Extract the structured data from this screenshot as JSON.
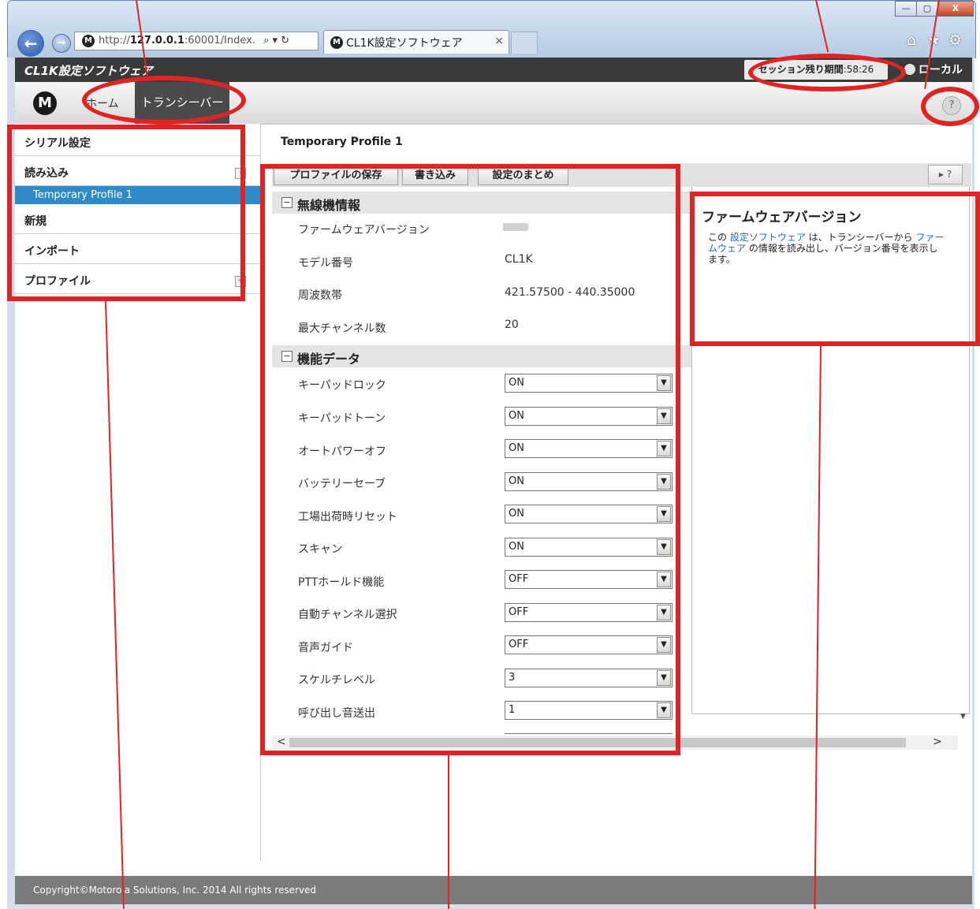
{
  "browser": {
    "address_prefix": "http://",
    "address_host": "127.0.0.1",
    "address_rest": ":60001/Index.",
    "address_tools": "⌕ ▾ ↻",
    "tab_title": "CL1K設定ソフトウェア",
    "tab_close": "×",
    "window_buttons": {
      "minimize": "—",
      "maximize": "▢",
      "close": "X"
    },
    "icons": {
      "home": "⌂",
      "favorites": "★",
      "settings": "⚙"
    }
  },
  "app": {
    "title": "CL1K設定ソフトウェア",
    "session_label": "セッション残り期間",
    "session_time": ":58:26",
    "local_label": "ローカル"
  },
  "nav": {
    "home": "ホーム",
    "transceiver": "トランシーバー",
    "help": "?"
  },
  "sidebar": {
    "items": [
      {
        "label": "シリアル設定"
      },
      {
        "label": "読み込み",
        "toggle": "-"
      },
      {
        "label": "新規"
      },
      {
        "label": "インポート"
      },
      {
        "label": "プロファイル",
        "toggle": "+"
      }
    ],
    "selected_sub": "Temporary Profile 1"
  },
  "main": {
    "title": "Temporary Profile 1",
    "toolbar": {
      "save": "プロファイルの保存",
      "write": "書き込み",
      "summary": "設定のまとめ",
      "panel_toggle": "▸ ?"
    },
    "radio_info": {
      "heading": "無線機情報",
      "collapse": "−",
      "rows": [
        {
          "label": "ファームウェアバージョン",
          "value": ""
        },
        {
          "label": "モデル番号",
          "value": "CL1K"
        },
        {
          "label": "周波数帯",
          "value": "421.57500 - 440.35000"
        },
        {
          "label": "最大チャンネル数",
          "value": "20"
        }
      ]
    },
    "function_data": {
      "heading": "機能データ",
      "collapse": "−",
      "rows": [
        {
          "label": "キーパッドロック",
          "value": "ON"
        },
        {
          "label": "キーパッドトーン",
          "value": "ON"
        },
        {
          "label": "オートパワーオフ",
          "value": "ON"
        },
        {
          "label": "バッテリーセーブ",
          "value": "ON"
        },
        {
          "label": "工場出荷時リセット",
          "value": "ON"
        },
        {
          "label": "スキャン",
          "value": "ON"
        },
        {
          "label": "PTTホールド機能",
          "value": "OFF"
        },
        {
          "label": "自動チャンネル選択",
          "value": "OFF"
        },
        {
          "label": "音声ガイド",
          "value": "OFF"
        },
        {
          "label": "スケルチレベル",
          "value": "3"
        },
        {
          "label": "呼び出し音送出",
          "value": "1"
        }
      ]
    },
    "dropdown_arrow": "▼",
    "scroll": {
      "left": "<",
      "right": ">"
    }
  },
  "help_panel": {
    "title": "ファームウェアバージョン",
    "text_1": "この ",
    "link_1": "設定ソフトウェア",
    "text_2": " は、トランシーバーから ",
    "link_2": "ファームウェア",
    "text_3": " の情報を読み出し、バージョン番号を表示します。"
  },
  "footer": {
    "copyright": "Copyright©Motorola Solutions, Inc. 2014 All rights reserved"
  },
  "colors": {
    "annotation": "#e02424",
    "selected": "#2e8bc8",
    "header": "#3a3a3a"
  }
}
